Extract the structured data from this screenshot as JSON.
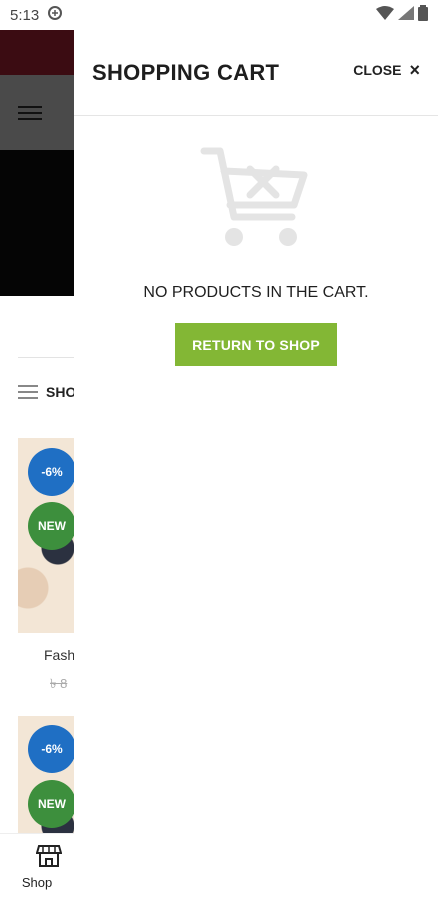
{
  "status_bar": {
    "time": "5:13"
  },
  "background_page": {
    "shop_menu_label": "SHO",
    "badges": {
      "sale": "-6%",
      "new": "NEW"
    },
    "product_name": "Fash",
    "product_price": "৳ 8",
    "bottom_nav": {
      "shop_label": "Shop"
    }
  },
  "cart": {
    "title": "SHOPPING CART",
    "close_label": "CLOSE",
    "close_icon": "×",
    "empty_message": "NO PRODUCTS IN THE CART.",
    "return_button": "RETURN TO SHOP",
    "accent_color": "#83b735"
  }
}
